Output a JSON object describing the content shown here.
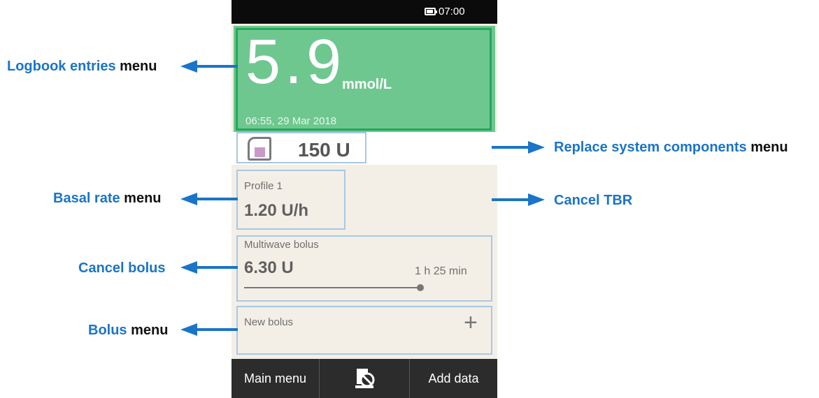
{
  "status_bar": {
    "time": "07:00"
  },
  "glucose": {
    "value": "5.9",
    "unit": "mmol/L",
    "timestamp": "06:55, 29 Mar 2018"
  },
  "cartridge": {
    "amount": "150 U"
  },
  "basal": {
    "profile": "Profile 1",
    "rate": "1.20 U/h"
  },
  "bolus_active": {
    "type": "Multiwave bolus",
    "amount": "6.30 U",
    "remaining": "1 h 25 min",
    "progress": 0.97
  },
  "new_bolus": {
    "label": "New bolus"
  },
  "bottom_bar": {
    "main_menu": "Main menu",
    "add_data": "Add data"
  },
  "annotations": {
    "logbook": {
      "highlight": "Logbook entries",
      "suffix": " menu"
    },
    "replace": {
      "highlight": "Replace system components",
      "suffix": " menu"
    },
    "basal": {
      "highlight": "Basal rate",
      "suffix": " menu"
    },
    "cancel_tbr": {
      "highlight": "Cancel TBR",
      "suffix": ""
    },
    "cancel_bolus": {
      "highlight": "Cancel bolus",
      "suffix": ""
    },
    "bolus": {
      "highlight": "Bolus",
      "suffix": " menu"
    }
  },
  "colors": {
    "annotation_blue": "#1a74c8",
    "glucose_green": "#6fc790",
    "frame_green": "#23a85a",
    "highlight_box": "#a8c8e4"
  }
}
